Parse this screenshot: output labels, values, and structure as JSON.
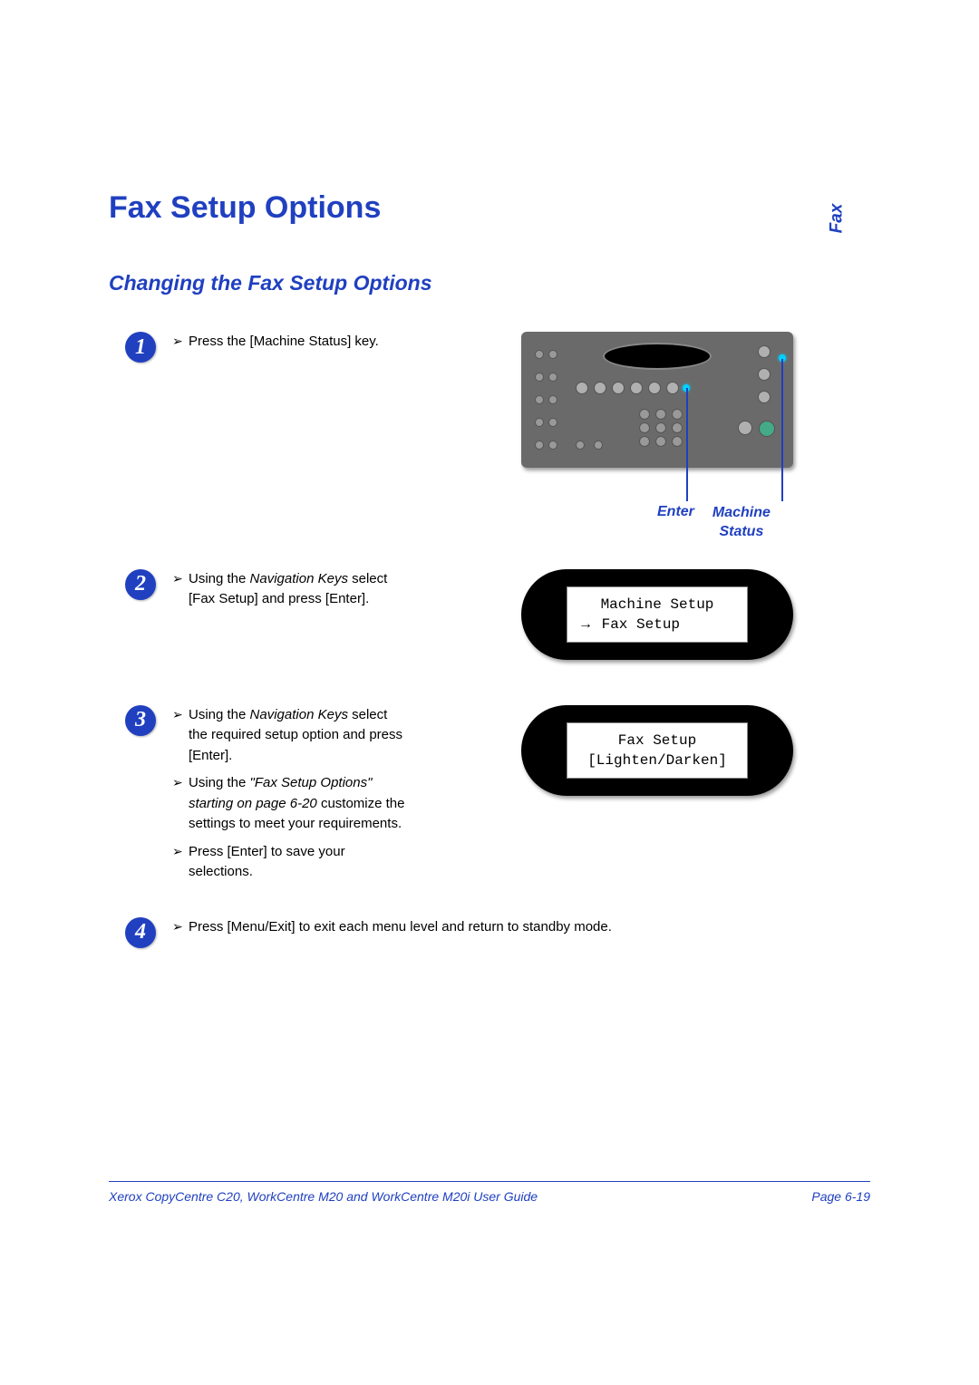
{
  "header": {
    "main_title": "Fax Setup Options",
    "subtitle": "Changing the Fax Setup Options",
    "side_label": "Fax"
  },
  "steps": {
    "s1": {
      "num": "1",
      "text1": "Press the [Machine Status] key."
    },
    "s2": {
      "num": "2",
      "text1_a": "Using the ",
      "text1_b": "Navigation Keys",
      "text1_c": " select [Fax Setup] and press [Enter]."
    },
    "s3": {
      "num": "3",
      "text1_a": "Using the ",
      "text1_b": "Navigation Keys",
      "text1_c": " select the required setup option and press [Enter].",
      "text2_a": "Using the ",
      "text2_b": "\"Fax Setup Options\" starting on page 6-20",
      "text2_c": " customize the settings to meet your requirements.",
      "text3": "Press [Enter] to save your selections."
    },
    "s4": {
      "num": "4",
      "text1": "Press [Menu/Exit] to exit each menu level and return to standby mode."
    }
  },
  "panel_labels": {
    "enter": "Enter",
    "machine_status": "Machine Status"
  },
  "lcd1": {
    "line1": "Machine Setup",
    "arrow": "→",
    "line2": " Fax Setup"
  },
  "lcd2": {
    "line1": "Fax Setup",
    "line2": "[Lighten/Darken]"
  },
  "footer": {
    "left": "Xerox CopyCentre C20, WorkCentre M20 and WorkCentre M20i User Guide",
    "right": "Page 6-19"
  },
  "bullet": "➢"
}
